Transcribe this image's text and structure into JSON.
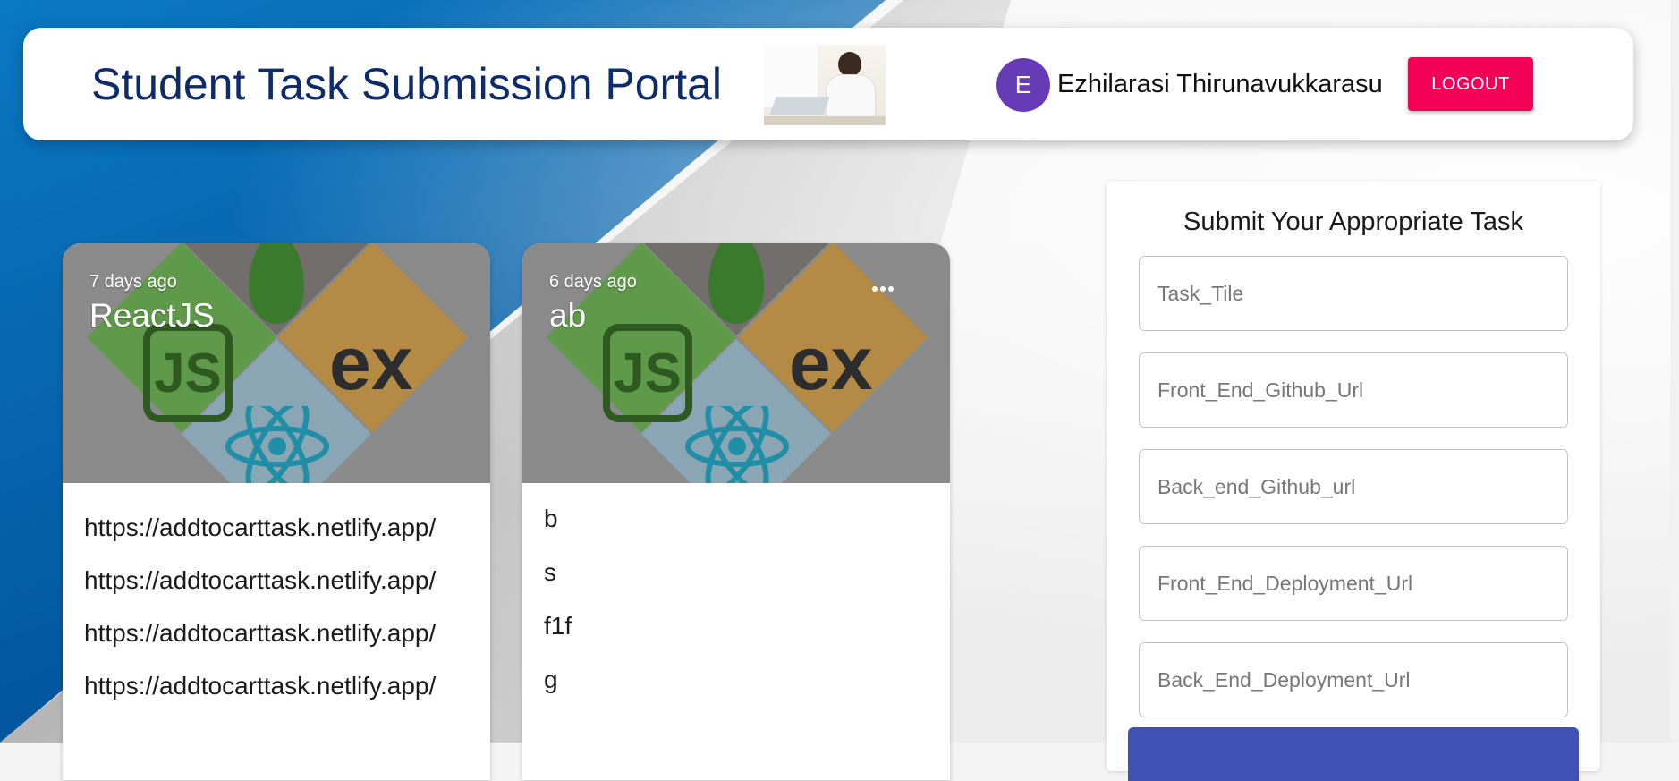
{
  "header": {
    "title": "Student Task Submission Portal",
    "user": {
      "avatar_letter": "E",
      "name": "Ezhilarasi Thirunavukkarasu"
    },
    "logout_label": "LOGOUT"
  },
  "cards": [
    {
      "time": "7 days ago",
      "title": "ReactJS",
      "lines": [
        "https://addtocarttask.netlify.app/",
        "https://addtocarttask.netlify.app/",
        "https://addtocarttask.netlify.app/",
        "https://addtocarttask.netlify.app/"
      ]
    },
    {
      "time": "6 days ago",
      "title": "ab",
      "lines": [
        "b",
        "s",
        "f1f",
        "g"
      ]
    }
  ],
  "form": {
    "title": "Submit Your Appropriate Task",
    "fields": [
      {
        "placeholder": "Task_Tile",
        "value": ""
      },
      {
        "placeholder": "Front_End_Github_Url",
        "value": ""
      },
      {
        "placeholder": "Back_end_Github_url",
        "value": ""
      },
      {
        "placeholder": "Front_End_Deployment_Url",
        "value": ""
      },
      {
        "placeholder": "Back_End_Deployment_Url",
        "value": ""
      }
    ]
  },
  "colors": {
    "primary": "#3f51b5",
    "logout": "#f50057",
    "avatar": "#673ab7",
    "title": "#0d2a6b",
    "background_blue": "#0459a0"
  },
  "icons": {
    "card_menu": "more-horizontal-icon",
    "card_image": "mern-stack-logo-image",
    "header_image": "student-laptop-photo"
  }
}
